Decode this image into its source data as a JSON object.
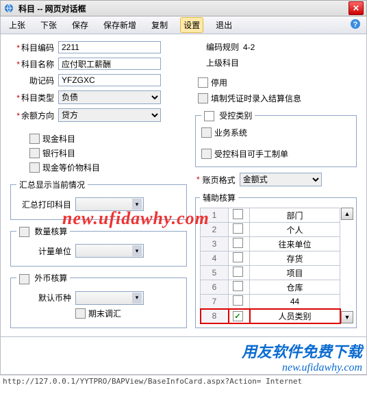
{
  "window": {
    "title": "科目 -- 网页对话框"
  },
  "toolbar": {
    "prev": "上张",
    "next": "下张",
    "save": "保存",
    "saveNew": "保存新增",
    "copy": "复制",
    "settings": "设置",
    "exit": "退出"
  },
  "form": {
    "code_label": "科目编码",
    "code_value": "2211",
    "name_label": "科目名称",
    "name_value": "应付职工薪酬",
    "mnemonic_label": "助记码",
    "mnemonic_value": "YFZGXC",
    "type_label": "科目类型",
    "type_value": "负债",
    "balance_label": "余额方向",
    "balance_value": "贷方"
  },
  "right": {
    "ruleLabel": "编码规则",
    "ruleValue": "4-2",
    "parentLabel": "上级科目",
    "disableLabel": "停用",
    "fillLabel": "填制凭证时录入结算信息"
  },
  "leftChecks": {
    "cash": "现金科目",
    "bank": "银行科目",
    "cashEq": "现金等价物科目"
  },
  "controlled": {
    "legend": "受控类别",
    "biz": "业务系统",
    "manual": "受控科目可手工制单"
  },
  "watermark": "new.ufidawhy.com",
  "summary": {
    "legend": "汇总显示当前情况",
    "printLabel": "汇总打印科目"
  },
  "pageFormat": {
    "label": "账页格式",
    "value": "金额式"
  },
  "qty": {
    "legend": "数量核算",
    "unitLabel": "计量单位"
  },
  "fx": {
    "legend": "外币核算",
    "currencyLabel": "默认币种",
    "endAdjLabel": "期末调汇"
  },
  "aux": {
    "legend": "辅助核算",
    "rows": [
      {
        "n": "1",
        "chk": false,
        "name": "部门"
      },
      {
        "n": "2",
        "chk": false,
        "name": "个人"
      },
      {
        "n": "3",
        "chk": false,
        "name": "往来单位"
      },
      {
        "n": "4",
        "chk": false,
        "name": "存货"
      },
      {
        "n": "5",
        "chk": false,
        "name": "项目"
      },
      {
        "n": "6",
        "chk": false,
        "name": "仓库"
      },
      {
        "n": "7",
        "chk": false,
        "name": "44"
      },
      {
        "n": "8",
        "chk": true,
        "name": "人员类别",
        "hl": true
      }
    ]
  },
  "bottomWatermark": {
    "line1": "用友软件免费下载",
    "line2": "new.ufidawhy.com"
  },
  "status": "http://127.0.0.1/YYTPRO/BAPView/BaseInfoCard.aspx?Action=  Internet"
}
